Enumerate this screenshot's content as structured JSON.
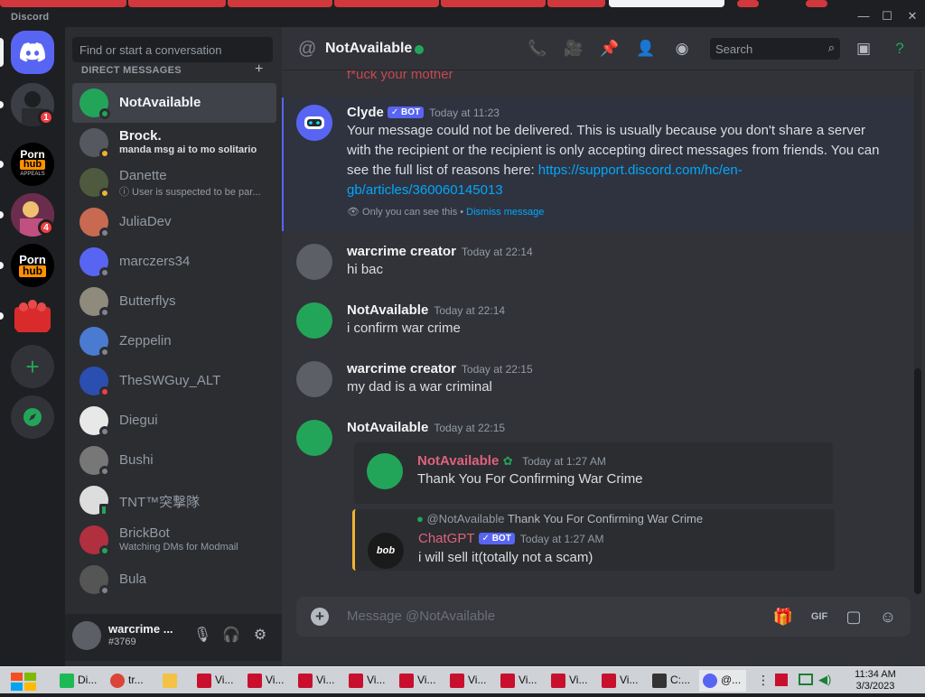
{
  "window": {
    "brand": "Discord",
    "minimize": "—",
    "maximize": "☐",
    "close": "✕"
  },
  "colors": {
    "blurple": "#5865f2",
    "online": "#23a559",
    "dnd": "#f23f43",
    "bg_main": "#313338"
  },
  "servers": [
    {
      "name": "server-1",
      "badge": "1"
    },
    {
      "name": "server-porn-appeals",
      "label": "Porn hub APPEALS"
    },
    {
      "name": "server-3",
      "badge": "4"
    },
    {
      "name": "server-porn-hub",
      "label": "Porn hub"
    },
    {
      "name": "server-roblox"
    }
  ],
  "dm_sidebar": {
    "search_placeholder": "Find or start a conversation",
    "header": "DIRECT MESSAGES",
    "add": "+",
    "items": [
      {
        "name": "NotAvailable"
      },
      {
        "name": "Brock.",
        "sub": "manda msg ai to mo solitario"
      },
      {
        "name": "Danette",
        "sub": "ⓘ User is suspected to be par..."
      },
      {
        "name": "JuliaDev"
      },
      {
        "name": "marczers34"
      },
      {
        "name": "Butterflys"
      },
      {
        "name": "Zeppelin"
      },
      {
        "name": "TheSWGuy_ALT"
      },
      {
        "name": "Diegui"
      },
      {
        "name": "Bushi"
      },
      {
        "name": "TNT™突撃隊"
      },
      {
        "name": "BrickBot",
        "sub": "Watching DMs for Modmail"
      },
      {
        "name": "Bula"
      }
    ]
  },
  "user_panel": {
    "username": "warcrime ...",
    "tag": "#3769"
  },
  "header": {
    "title": "NotAvailable",
    "search_placeholder": "Search"
  },
  "messages": {
    "top_clipped": "f*uck your mother",
    "clyde": {
      "author": "Clyde",
      "bot": "✓ BOT",
      "time": "Today at 11:23",
      "text": "Your message could not be delivered. This is usually because you don't share a server with the recipient or the recipient is only accepting direct messages from friends. You can see the full list of reasons here: ",
      "link": "https://support.discord.com/hc/en-gb/articles/360060145013",
      "only_you": "Only you can see this •",
      "dismiss": "Dismiss message"
    },
    "m1": {
      "author": "warcrime creator",
      "time": "Today at 22:14",
      "text": "hi bac"
    },
    "m2": {
      "author": "NotAvailable",
      "time": "Today at 22:14",
      "text": "i confirm war crime"
    },
    "m3": {
      "author": "warcrime creator",
      "time": "Today at 22:15",
      "text": "my dad is a war criminal"
    },
    "m4": {
      "author": "NotAvailable",
      "time": "Today at 22:15",
      "embed1": {
        "author": "NotAvailable",
        "time": "Today at 1:27 AM",
        "text": "Thank You For Confirming War Crime"
      },
      "embed2": {
        "reply_mention": "@NotAvailable",
        "reply_text": "Thank You For Confirming War Crime",
        "author": "ChatGPT",
        "bot": "✓ BOT",
        "time": "Today at 1:27 AM",
        "avatar_label": "bob",
        "text": "i will sell it(totally not a scam)"
      }
    }
  },
  "composer": {
    "placeholder": "Message @NotAvailable",
    "gif": "GIF"
  },
  "taskbar": {
    "apps": [
      "Di...",
      "tr...",
      "",
      "Vi...",
      "Vi...",
      "Vi...",
      "Vi...",
      "Vi...",
      "Vi...",
      "Vi...",
      "Vi...",
      "Vi...",
      "C:...",
      "@..."
    ],
    "time": "11:34 AM",
    "date": "3/3/2023"
  }
}
